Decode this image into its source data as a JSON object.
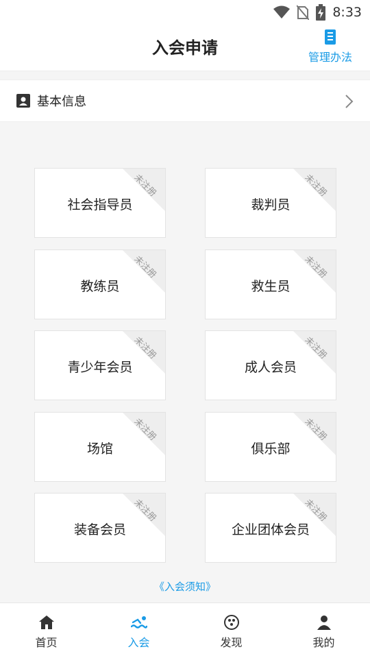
{
  "status_bar": {
    "time": "8:33"
  },
  "header": {
    "title": "入会申请",
    "mgmt_label": "管理办法"
  },
  "info_row": {
    "label": "基本信息"
  },
  "cards": [
    {
      "name": "社会指导员",
      "status": "未注册"
    },
    {
      "name": "裁判员",
      "status": "未注册"
    },
    {
      "name": "教练员",
      "status": "未注册"
    },
    {
      "name": "救生员",
      "status": "未注册"
    },
    {
      "name": "青少年会员",
      "status": "未注册"
    },
    {
      "name": "成人会员",
      "status": "未注册"
    },
    {
      "name": "场馆",
      "status": "未注册"
    },
    {
      "name": "俱乐部",
      "status": "未注册"
    },
    {
      "name": "装备会员",
      "status": "未注册"
    },
    {
      "name": "企业团体会员",
      "status": "未注册"
    }
  ],
  "notice": "《入会须知》",
  "tabs": [
    {
      "label": "首页",
      "icon": "home-icon",
      "active": false
    },
    {
      "label": "入会",
      "icon": "swimmer-icon",
      "active": true
    },
    {
      "label": "发现",
      "icon": "discover-icon",
      "active": false
    },
    {
      "label": "我的",
      "icon": "person-icon",
      "active": false
    }
  ],
  "colors": {
    "accent": "#1a9be6",
    "background": "#f5f5f5"
  }
}
